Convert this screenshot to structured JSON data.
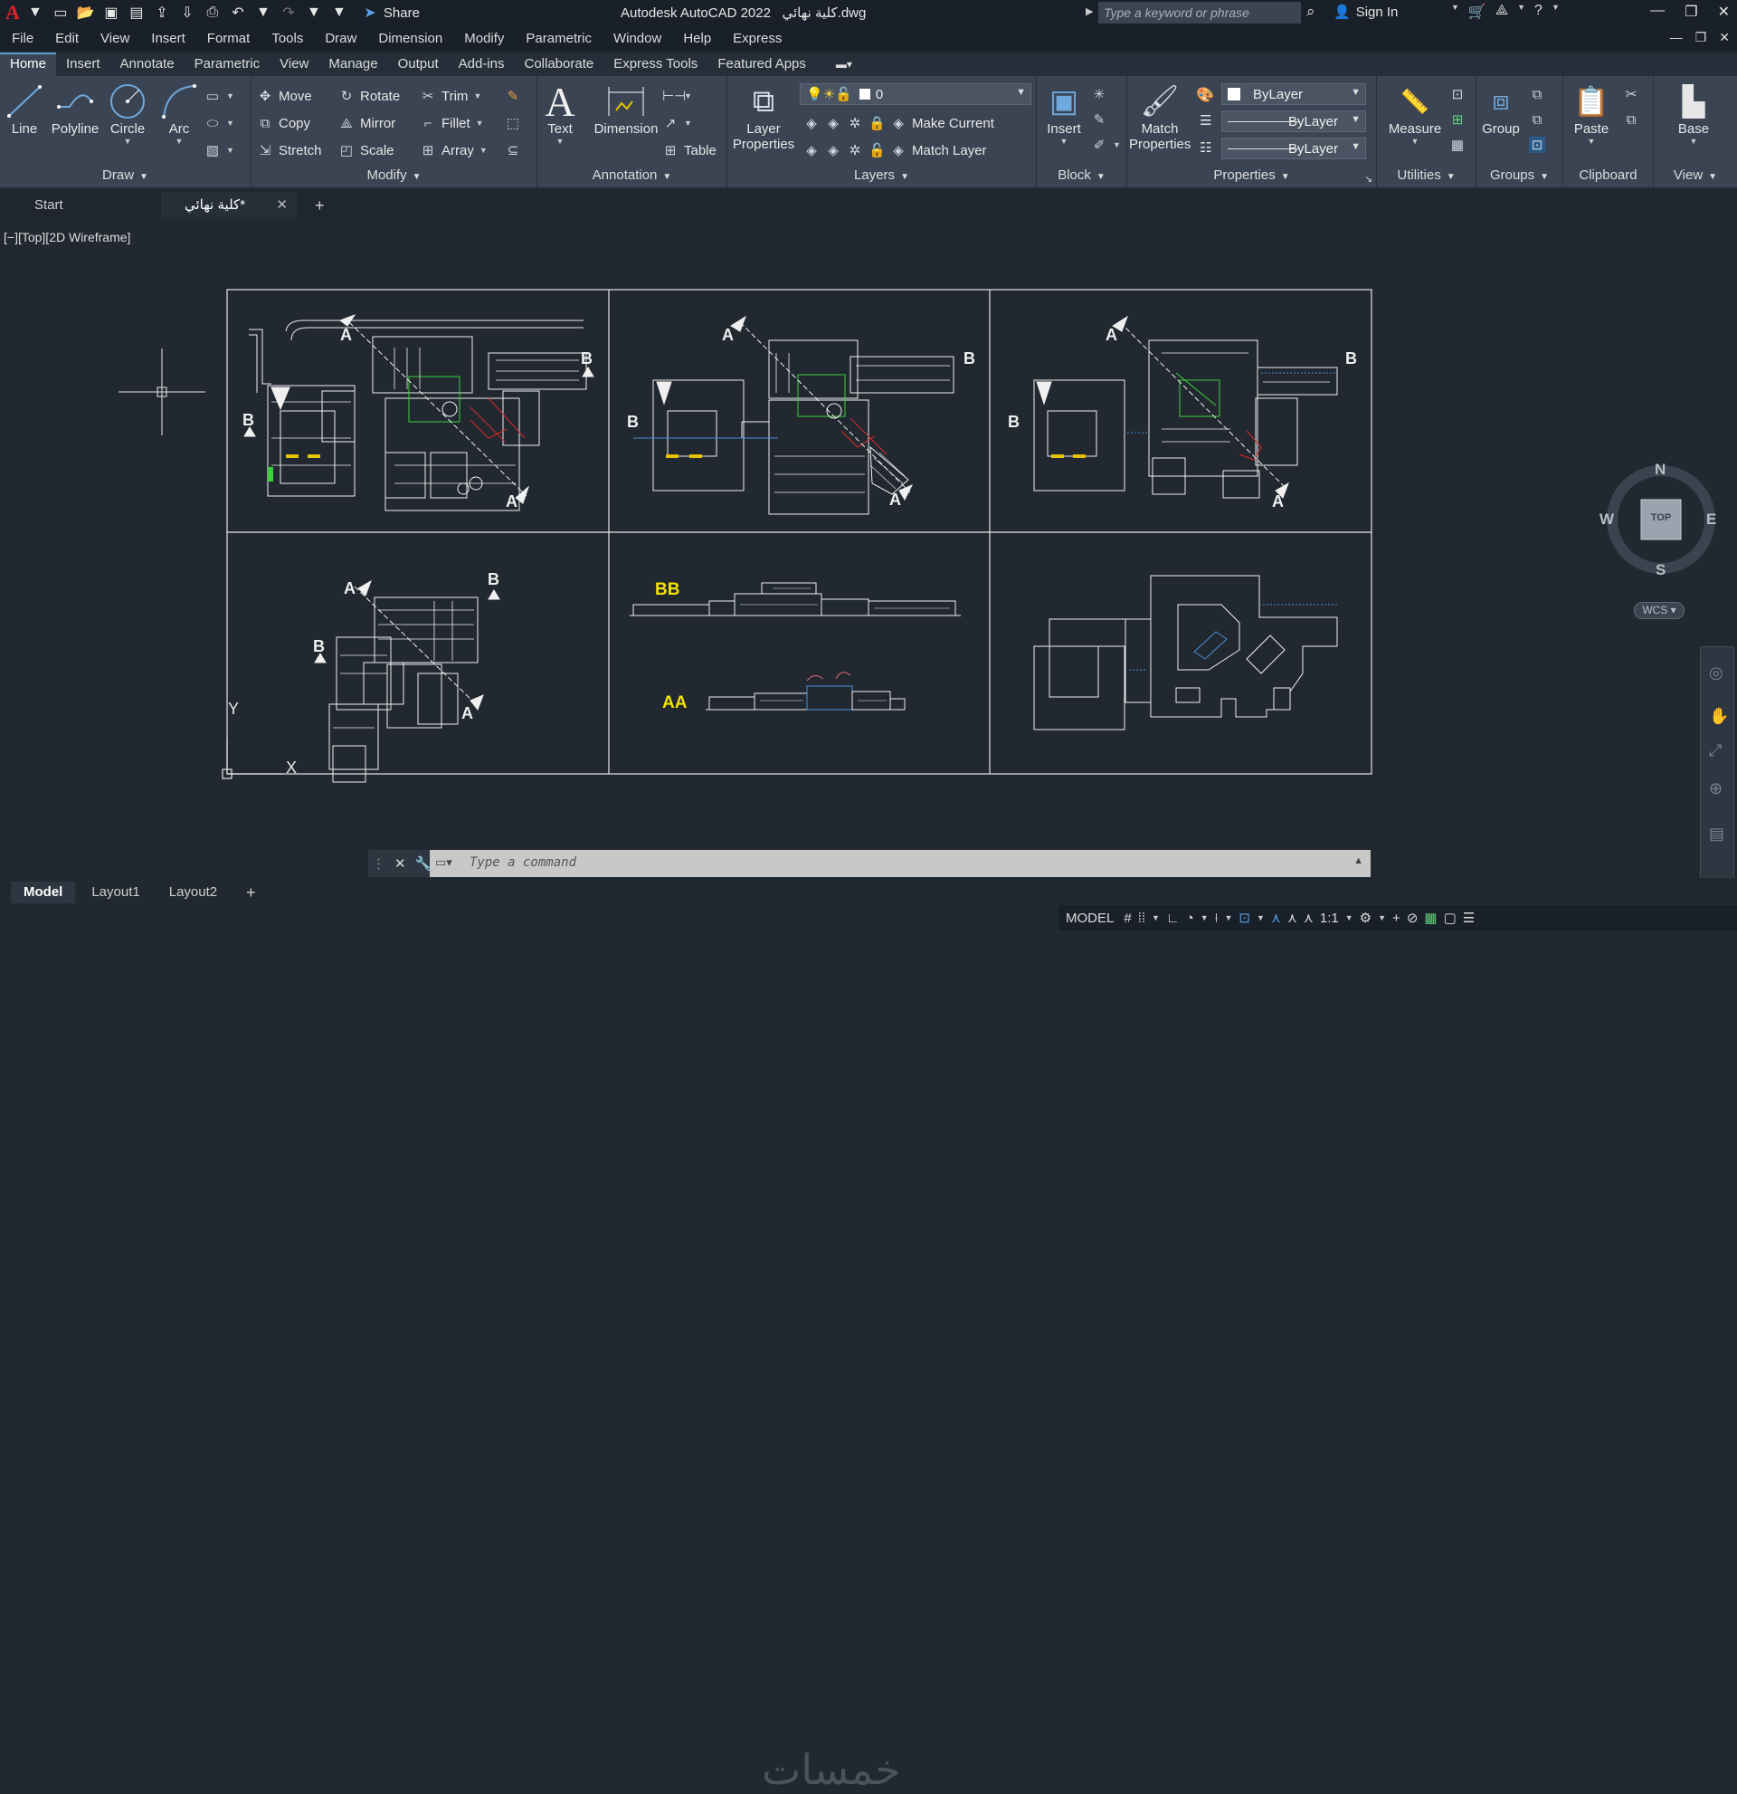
{
  "app": {
    "title": "Autodesk AutoCAD 2022",
    "filename": "كلية نهائي.dwg",
    "share_label": "Share",
    "search_placeholder": "Type a keyword or phrase",
    "signin_label": "Sign In",
    "accent_color": "#5d9fd8"
  },
  "menu": [
    "File",
    "Edit",
    "View",
    "Insert",
    "Format",
    "Tools",
    "Draw",
    "Dimension",
    "Modify",
    "Parametric",
    "Window",
    "Help",
    "Express"
  ],
  "ribbon_tabs": [
    "Home",
    "Insert",
    "Annotate",
    "Parametric",
    "View",
    "Manage",
    "Output",
    "Add-ins",
    "Collaborate",
    "Express Tools",
    "Featured Apps"
  ],
  "active_tab": "Home",
  "draw": {
    "title": "Draw",
    "line": "Line",
    "polyline": "Polyline",
    "circle": "Circle",
    "arc": "Arc"
  },
  "modify": {
    "title": "Modify",
    "move": "Move",
    "rotate": "Rotate",
    "trim": "Trim",
    "copy": "Copy",
    "mirror": "Mirror",
    "fillet": "Fillet",
    "stretch": "Stretch",
    "scale": "Scale",
    "array": "Array"
  },
  "annotation": {
    "title": "Annotation",
    "text": "Text",
    "dimension": "Dimension",
    "table": "Table"
  },
  "layers": {
    "title": "Layers",
    "layer_properties_1": "Layer",
    "layer_properties_2": "Properties",
    "current_layer": "0",
    "make_current": "Make Current",
    "match_layer": "Match Layer"
  },
  "block": {
    "title": "Block",
    "insert": "Insert"
  },
  "properties": {
    "title": "Properties",
    "match_1": "Match",
    "match_2": "Properties",
    "color": "ByLayer",
    "linetype": "ByLayer",
    "lineweight": "ByLayer"
  },
  "utilities": {
    "title": "Utilities",
    "measure": "Measure"
  },
  "groups": {
    "title": "Groups",
    "group": "Group"
  },
  "clipboard": {
    "title": "Clipboard",
    "paste": "Paste"
  },
  "view_panel": {
    "title": "View",
    "base": "Base"
  },
  "file_tabs": {
    "start": "Start",
    "current": "كلية نهائي*"
  },
  "viewport_label": "[−][Top][2D Wireframe]",
  "navcube": {
    "n": "N",
    "s": "S",
    "e": "E",
    "w": "W",
    "face": "TOP",
    "wcs": "WCS"
  },
  "drawing": {
    "label_bb": "BB",
    "label_aa": "AA",
    "section_a": "A",
    "section_b": "B",
    "ucs_x": "X",
    "ucs_y": "Y",
    "highlight_color": "#f2e300"
  },
  "command": {
    "placeholder": "Type a command"
  },
  "layout_tabs": [
    "Model",
    "Layout1",
    "Layout2"
  ],
  "status": {
    "model": "MODEL",
    "scale": "1:1"
  }
}
